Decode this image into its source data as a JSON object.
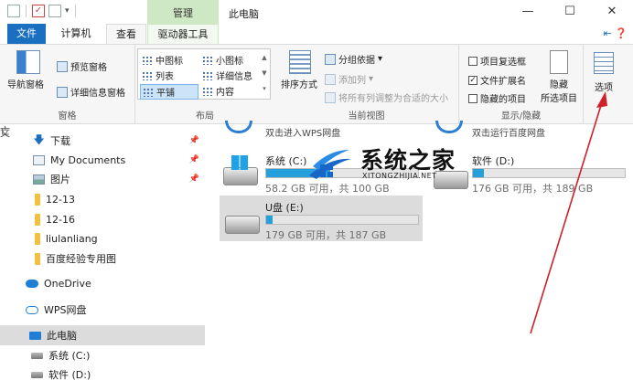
{
  "window": {
    "title": "此电脑",
    "context_tab_header": "管理",
    "controls": {
      "minimize": "—",
      "maximize": "☐",
      "close": "✕"
    }
  },
  "tabs": [
    {
      "label": "文件"
    },
    {
      "label": "计算机"
    },
    {
      "label": "查看"
    },
    {
      "label": "驱动器工具"
    }
  ],
  "ribbon": {
    "panes": {
      "label": "窗格",
      "nav_pane": "导航窗格",
      "preview_pane": "预览窗格",
      "details_pane": "详细信息窗格"
    },
    "layout": {
      "label": "布局",
      "items": [
        "中图标",
        "小图标",
        "列表",
        "详细信息",
        "平铺",
        "内容"
      ],
      "selected": "平铺"
    },
    "current_view": {
      "label": "当前视图",
      "sort_by": "排序方式",
      "group_by": "分组依据",
      "add_column": "添加列",
      "size_all_columns": "将所有列调整为合适的大小"
    },
    "show_hide": {
      "label": "显示/隐藏",
      "item_checkboxes": {
        "label": "项目复选框",
        "checked": false
      },
      "file_extensions": {
        "label": "文件扩展名",
        "checked": true
      },
      "hidden_items": {
        "label": "隐藏的项目",
        "checked": false
      },
      "hide_selected_line1": "隐藏",
      "hide_selected_line2": "所选项目"
    },
    "options": {
      "label": "选项"
    }
  },
  "nav": {
    "edge_marks": [
      "亡",
      "文"
    ],
    "items": [
      {
        "label": "下载",
        "icon": "download-arrow-icon",
        "pinned": true
      },
      {
        "label": "My Documents",
        "icon": "document-icon",
        "pinned": true
      },
      {
        "label": "图片",
        "icon": "picture-icon",
        "pinned": true
      },
      {
        "label": "12-13",
        "icon": "folder-icon"
      },
      {
        "label": "12-16",
        "icon": "folder-icon"
      },
      {
        "label": "liulanliang",
        "icon": "folder-icon"
      },
      {
        "label": "百度经验专用图",
        "icon": "folder-icon"
      },
      {
        "label": "OneDrive",
        "icon": "cloud-icon"
      },
      {
        "label": "WPS网盘",
        "icon": "cloud-outline-icon"
      },
      {
        "label": "此电脑",
        "icon": "computer-icon",
        "selected": true
      },
      {
        "label": "系统 (C:)",
        "icon": "drive-icon"
      },
      {
        "label": "软件 (D:)",
        "icon": "drive-icon"
      }
    ]
  },
  "content": {
    "top_links": [
      "双击进入WPS网盘",
      "双击运行百度网盘"
    ],
    "drives": [
      {
        "name": "系统 (C:)",
        "free_text": "58.2 GB 可用，共 100 GB",
        "used_fraction": 0.42
      },
      {
        "name": "软件 (D:)",
        "free_text": "176 GB 可用，共 189 GB",
        "used_fraction": 0.07
      },
      {
        "name": "U盘 (E:)",
        "free_text": "179 GB 可用，共 187 GB",
        "used_fraction": 0.04,
        "selected": true
      }
    ]
  },
  "watermark": {
    "text": "系统之家",
    "sub": "XITONGZHIJIA.NET"
  },
  "colors": {
    "accent": "#1a6fc0",
    "context_tab": "#cfe8c4",
    "drive_bar": "#26a0da",
    "annotation": "#d0202a"
  }
}
